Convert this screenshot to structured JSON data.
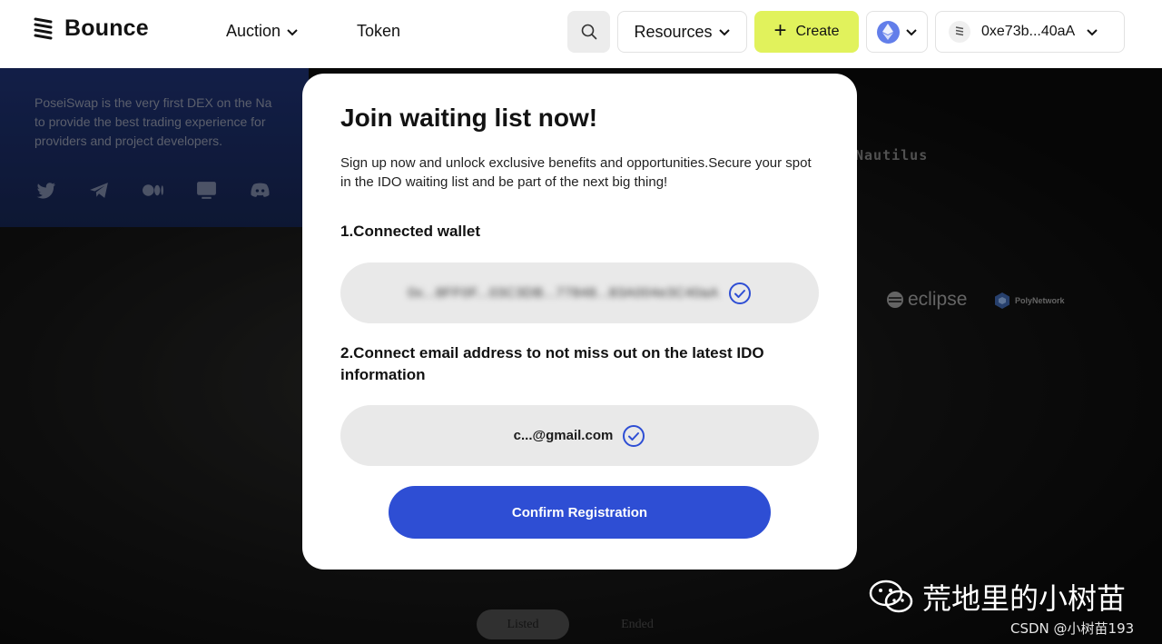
{
  "header": {
    "logo_text": "Bounce",
    "nav": [
      {
        "label": "Auction",
        "has_dropdown": true
      },
      {
        "label": "Token",
        "has_dropdown": false
      }
    ],
    "resources_label": "Resources",
    "create_label": "Create",
    "wallet_address": "0xe73b...40aA",
    "accent_color": "#e1f25c"
  },
  "background": {
    "description": "PoseiSwap is the very first DEX on the Na\nto provide the best trading experience for\nproviders and project developers.",
    "partners": [
      "Nautilus",
      "eclipse",
      "PolyNetwork"
    ],
    "tabs": [
      {
        "label": "Listed",
        "active": true
      },
      {
        "label": "Ended",
        "active": false
      }
    ]
  },
  "modal": {
    "title": "Join waiting list now!",
    "description": "Sign up now and unlock exclusive benefits and opportunities.Secure your spot in the IDO waiting list and be part of the next big thing!",
    "step1_label": "1.Connected wallet",
    "wallet_value": "0x...8FF0F...03C3DB...77848...83A004e3C40aA",
    "step2_label": "2.Connect email address to not miss out on the latest IDO information",
    "email_value": "c...@gmail.com",
    "confirm_label": "Confirm Registration",
    "button_color": "#2e4ed4"
  },
  "watermark": {
    "channel": "荒地里的小树苗",
    "csdn": "CSDN @小树苗193"
  }
}
